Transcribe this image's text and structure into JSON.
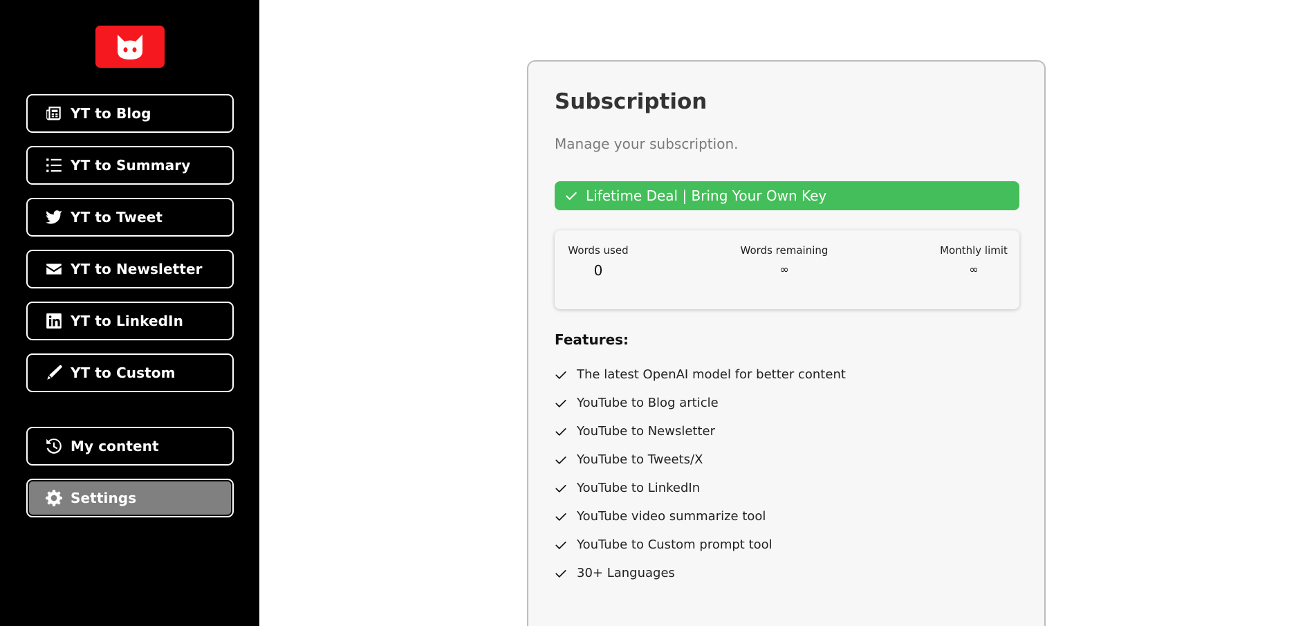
{
  "sidebar": {
    "logo": "cat-logo-icon",
    "nav": [
      {
        "label": "YT to Blog",
        "icon": "newspaper-icon"
      },
      {
        "label": "YT to Summary",
        "icon": "list-icon"
      },
      {
        "label": "YT to Tweet",
        "icon": "twitter-icon"
      },
      {
        "label": "YT to Newsletter",
        "icon": "envelope-icon"
      },
      {
        "label": "YT to LinkedIn",
        "icon": "linkedin-icon"
      },
      {
        "label": "YT to Custom",
        "icon": "pen-icon"
      }
    ],
    "secondary": [
      {
        "label": "My content",
        "icon": "history-icon"
      },
      {
        "label": "Settings",
        "icon": "gear-icon",
        "active": true
      }
    ]
  },
  "subscription": {
    "title": "Subscription",
    "subtitle": "Manage your subscription.",
    "plan": "Lifetime Deal | Bring Your Own Key",
    "plan_color": "#44be5a",
    "stats": {
      "words_used_label": "Words used",
      "words_used_value": "0",
      "words_remaining_label": "Words remaining",
      "words_remaining_value": "∞",
      "monthly_limit_label": "Monthly limit",
      "monthly_limit_value": "∞"
    },
    "features_title": "Features:",
    "features": [
      "The latest OpenAI model for better content",
      "YouTube to Blog article",
      "YouTube to Newsletter",
      "YouTube to Tweets/X",
      "YouTube to LinkedIn",
      "YouTube video summarize tool",
      "YouTube to Custom prompt tool",
      "30+ Languages"
    ]
  },
  "colors": {
    "brand": "#f5191f",
    "sidebar_bg": "#000000",
    "active_nav": "#808080"
  }
}
